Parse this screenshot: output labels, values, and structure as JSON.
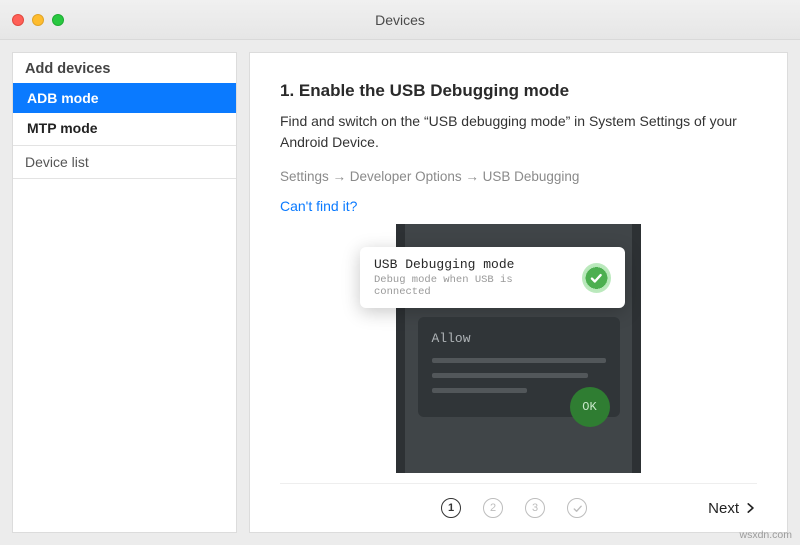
{
  "window": {
    "title": "Devices"
  },
  "sidebar": {
    "header": "Add devices",
    "items": [
      {
        "label": "ADB mode",
        "selected": true
      },
      {
        "label": "MTP mode",
        "selected": false
      }
    ],
    "section": "Device list"
  },
  "main": {
    "heading": "1. Enable the USB Debugging mode",
    "description": "Find and switch on the “USB debugging mode” in System Settings of your Android Device.",
    "breadcrumb": "Settings → Developer Options → USB Debugging",
    "help_link": "Can't find it?"
  },
  "illustration": {
    "toast_title": "USB Debugging mode",
    "toast_sub": "Debug mode when USB is connected",
    "dialog_label": "Allow",
    "ok_label": "OK"
  },
  "footer": {
    "steps": [
      "1",
      "2",
      "3"
    ],
    "next_label": "Next"
  },
  "watermark": "wsxdn.com"
}
